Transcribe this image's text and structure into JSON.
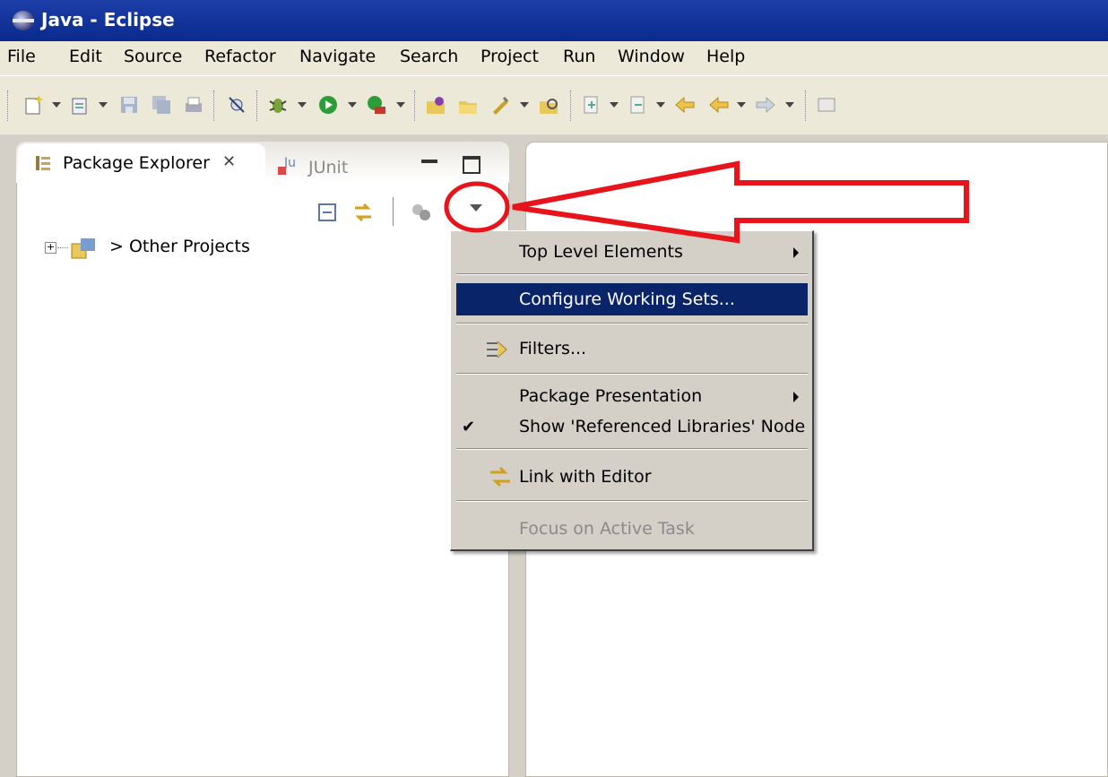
{
  "window": {
    "title": "Java - Eclipse"
  },
  "menubar": {
    "items": [
      "File",
      "Edit",
      "Source",
      "Refactor",
      "Navigate",
      "Search",
      "Project",
      "Run",
      "Window",
      "Help"
    ]
  },
  "explorer": {
    "tabs": [
      {
        "label": "Package Explorer",
        "icon": "package-explorer-icon",
        "closable": true
      },
      {
        "label": "JUnit",
        "icon": "junit-icon"
      }
    ],
    "tree": [
      {
        "label": "> Other Projects",
        "icon": "working-set-icon",
        "expander": "plus"
      }
    ]
  },
  "view_menu": {
    "items": [
      {
        "label": "Top Level Elements",
        "submenu": true
      },
      {
        "label": "Configure Working Sets...",
        "highlighted": true
      },
      {
        "label": "Filters...",
        "icon": "filters-icon"
      },
      {
        "label": "Package Presentation",
        "submenu": true
      },
      {
        "label": "Show 'Referenced Libraries' Node",
        "checked": true
      },
      {
        "label": "Link with Editor",
        "icon": "link-with-editor-icon"
      },
      {
        "label": "Focus on Active Task",
        "disabled": true
      }
    ]
  },
  "colors": {
    "selection": "#0a246a",
    "titlebar": "#0a2a8c",
    "annotation": "#e8141b"
  }
}
